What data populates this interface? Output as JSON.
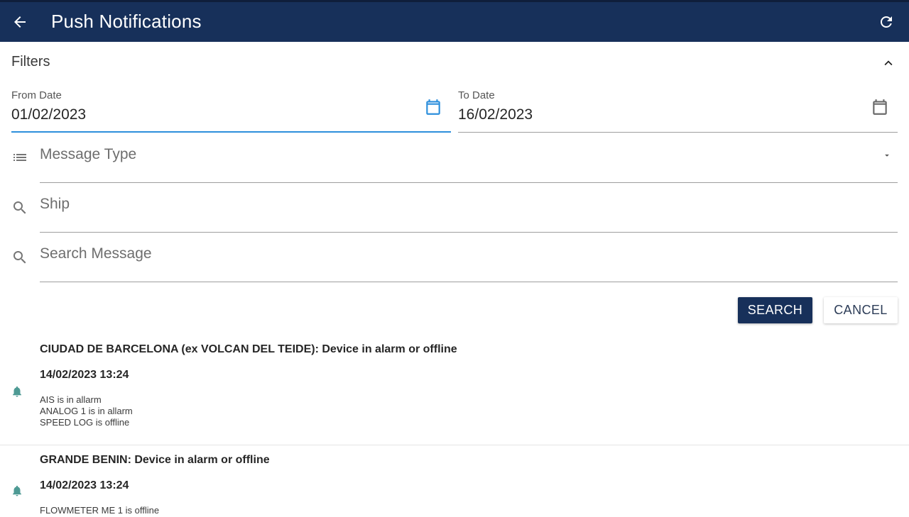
{
  "header": {
    "title": "Push Notifications",
    "back_icon": "arrow-back-icon",
    "refresh_icon": "refresh-icon",
    "background_color": "#17305a"
  },
  "filters": {
    "title": "Filters",
    "collapse_icon": "chevron-up-icon",
    "from_date": {
      "label": "From Date",
      "value": "01/02/2023",
      "icon": "calendar-icon",
      "accent_color": "#2d8fdc"
    },
    "to_date": {
      "label": "To Date",
      "value": "16/02/2023",
      "icon": "calendar-icon"
    },
    "message_type": {
      "placeholder": "Message Type",
      "icon": "list-icon",
      "caret_icon": "dropdown-caret-icon"
    },
    "ship": {
      "placeholder": "Ship",
      "icon": "search-icon"
    },
    "search_message": {
      "placeholder": "Search Message",
      "icon": "search-icon"
    },
    "search_label": "SEARCH",
    "cancel_label": "CANCEL"
  },
  "notifications": [
    {
      "title": "CIUDAD DE BARCELONA (ex VOLCAN DEL TEIDE): Device in alarm or offline",
      "date": "14/02/2023 13:24",
      "lines": [
        "AIS is in allarm",
        "ANALOG 1 is in allarm",
        "SPEED LOG is offline"
      ],
      "icon": "bell-icon",
      "icon_color": "#4e9a94"
    },
    {
      "title": "GRANDE BENIN: Device in alarm or offline",
      "date": "14/02/2023 13:24",
      "lines": [
        "FLOWMETER ME 1 is offline"
      ],
      "icon": "bell-icon",
      "icon_color": "#4e9a94"
    }
  ]
}
